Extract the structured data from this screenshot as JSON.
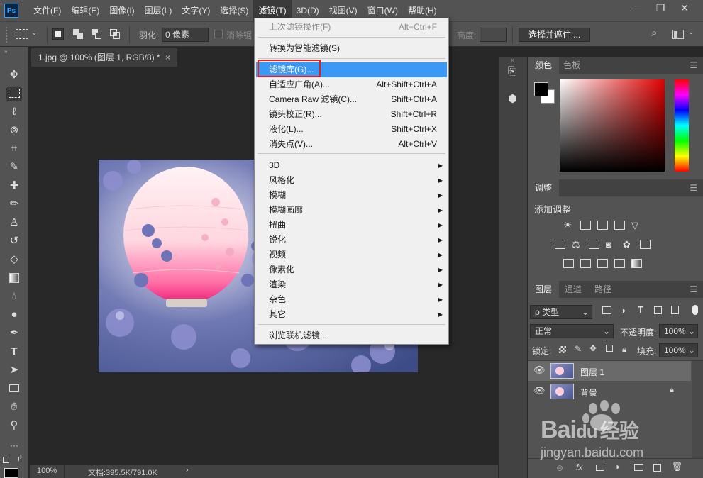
{
  "app": {
    "logo": "Ps"
  },
  "menubar": {
    "items": [
      "文件(F)",
      "编辑(E)",
      "图像(I)",
      "图层(L)",
      "文字(Y)",
      "选择(S)",
      "滤镜(T)",
      "3D(D)",
      "视图(V)",
      "窗口(W)",
      "帮助(H)"
    ],
    "active_index": 6
  },
  "window_controls": {
    "minimize": "—",
    "restore": "❐",
    "close": "✕"
  },
  "options": {
    "feather_label": "羽化:",
    "feather_value": "0 像素",
    "antialias_label": "消除锯",
    "height_label": "高度:",
    "select_mask_label": "选择并遮住 ..."
  },
  "document": {
    "tab_title": "1.jpg @ 100% (图层 1, RGB/8) *",
    "zoom": "100%",
    "doc_size": "文档:395.5K/791.0K"
  },
  "filter_menu": {
    "items": [
      {
        "label": "上次滤镜操作(F)",
        "shortcut": "Alt+Ctrl+F",
        "disabled": true
      },
      {
        "label": "转换为智能滤镜(S)"
      },
      {
        "label": "滤镜库(G)...",
        "highlighted": true
      },
      {
        "label": "自适应广角(A)...",
        "shortcut": "Alt+Shift+Ctrl+A"
      },
      {
        "label": "Camera Raw 滤镜(C)...",
        "shortcut": "Shift+Ctrl+A"
      },
      {
        "label": "镜头校正(R)...",
        "shortcut": "Shift+Ctrl+R"
      },
      {
        "label": "液化(L)...",
        "shortcut": "Shift+Ctrl+X"
      },
      {
        "label": "消失点(V)...",
        "shortcut": "Alt+Ctrl+V"
      },
      {
        "label": "3D",
        "submenu": true
      },
      {
        "label": "风格化",
        "submenu": true
      },
      {
        "label": "模糊",
        "submenu": true
      },
      {
        "label": "模糊画廊",
        "submenu": true
      },
      {
        "label": "扭曲",
        "submenu": true
      },
      {
        "label": "锐化",
        "submenu": true
      },
      {
        "label": "视频",
        "submenu": true
      },
      {
        "label": "像素化",
        "submenu": true
      },
      {
        "label": "渲染",
        "submenu": true
      },
      {
        "label": "杂色",
        "submenu": true
      },
      {
        "label": "其它",
        "submenu": true
      },
      {
        "label": "浏览联机滤镜..."
      }
    ],
    "submenu_arrow": "▶"
  },
  "color_panel": {
    "tabs": [
      "颜色",
      "色板"
    ],
    "foreground": "#000000",
    "background": "#ffffff"
  },
  "adjust_panel": {
    "tab": "调整",
    "title": "添加调整"
  },
  "layers_panel": {
    "tabs": [
      "图层",
      "通道",
      "路径"
    ],
    "filter_kind": "ρ 类型",
    "blend_mode": "正常",
    "opacity_label": "不透明度:",
    "opacity_value": "100%",
    "lock_label": "锁定:",
    "fill_label": "填充:",
    "fill_value": "100%",
    "layers": [
      {
        "name": "图层 1",
        "active": true,
        "locked": false
      },
      {
        "name": "背景",
        "active": false,
        "locked": true
      }
    ],
    "footer_fx": "fx"
  },
  "watermark": {
    "brand": "Bai",
    "brand2": "du",
    "cn": "经验",
    "url": "jingyan.baidu.com"
  },
  "colors": {
    "highlight": "#3b98f4",
    "focus_box": "#e02020",
    "panel": "#535353",
    "canvas": "#282828"
  }
}
